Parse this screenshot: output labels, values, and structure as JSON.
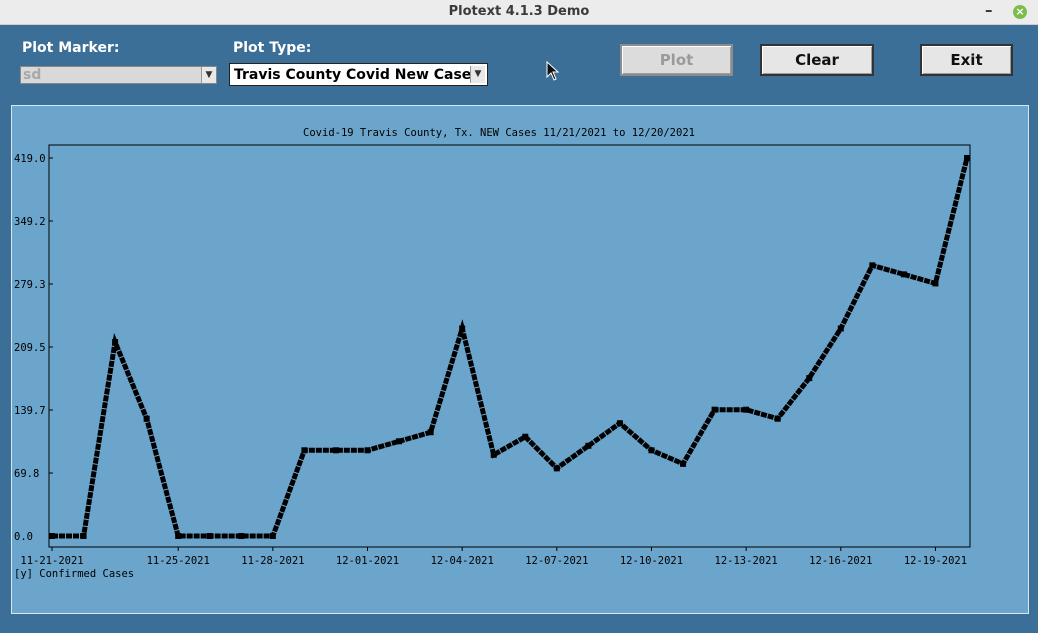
{
  "window": {
    "title": "Plotext 4.1.3 Demo",
    "minimize_icon": "minimize-icon",
    "close_icon": "close-icon",
    "close_color": "#7bbd4a"
  },
  "controls": {
    "marker_label": "Plot Marker:",
    "marker_value": "sd",
    "type_label": "Plot Type:",
    "type_value": "Travis County Covid New Cases",
    "plot_button": "Plot",
    "clear_button": "Clear",
    "exit_button": "Exit"
  },
  "colors": {
    "window_bg": "#3b6f97",
    "plot_bg": "#6ba5cc",
    "line": "#000000"
  },
  "chart_data": {
    "type": "line",
    "title": "Covid-19 Travis County, Tx. NEW Cases 11/21/2021 to 12/20/2021",
    "ylabel": "[y] Confirmed Cases",
    "xlabel": "",
    "yticks": [
      "0.0",
      "69.8",
      "139.7",
      "209.5",
      "279.3",
      "349.2",
      "419.0"
    ],
    "ylim": [
      0,
      419.0
    ],
    "xticks": [
      "11-21-2021",
      "11-25-2021",
      "11-28-2021",
      "12-01-2021",
      "12-04-2021",
      "12-07-2021",
      "12-10-2021",
      "12-13-2021",
      "12-16-2021",
      "12-19-2021"
    ],
    "x": [
      "11-21-2021",
      "11-22-2021",
      "11-23-2021",
      "11-24-2021",
      "11-25-2021",
      "11-26-2021",
      "11-27-2021",
      "11-28-2021",
      "11-29-2021",
      "11-30-2021",
      "12-01-2021",
      "12-02-2021",
      "12-03-2021",
      "12-04-2021",
      "12-05-2021",
      "12-06-2021",
      "12-07-2021",
      "12-08-2021",
      "12-09-2021",
      "12-10-2021",
      "12-11-2021",
      "12-12-2021",
      "12-13-2021",
      "12-14-2021",
      "12-15-2021",
      "12-16-2021",
      "12-17-2021",
      "12-18-2021",
      "12-19-2021",
      "12-20-2021"
    ],
    "values": [
      0,
      0,
      215,
      130,
      0,
      0,
      0,
      0,
      95,
      95,
      95,
      105,
      115,
      230,
      90,
      110,
      75,
      100,
      125,
      95,
      80,
      140,
      140,
      130,
      175,
      230,
      300,
      290,
      280,
      419
    ],
    "grid": false,
    "legend": "none"
  }
}
